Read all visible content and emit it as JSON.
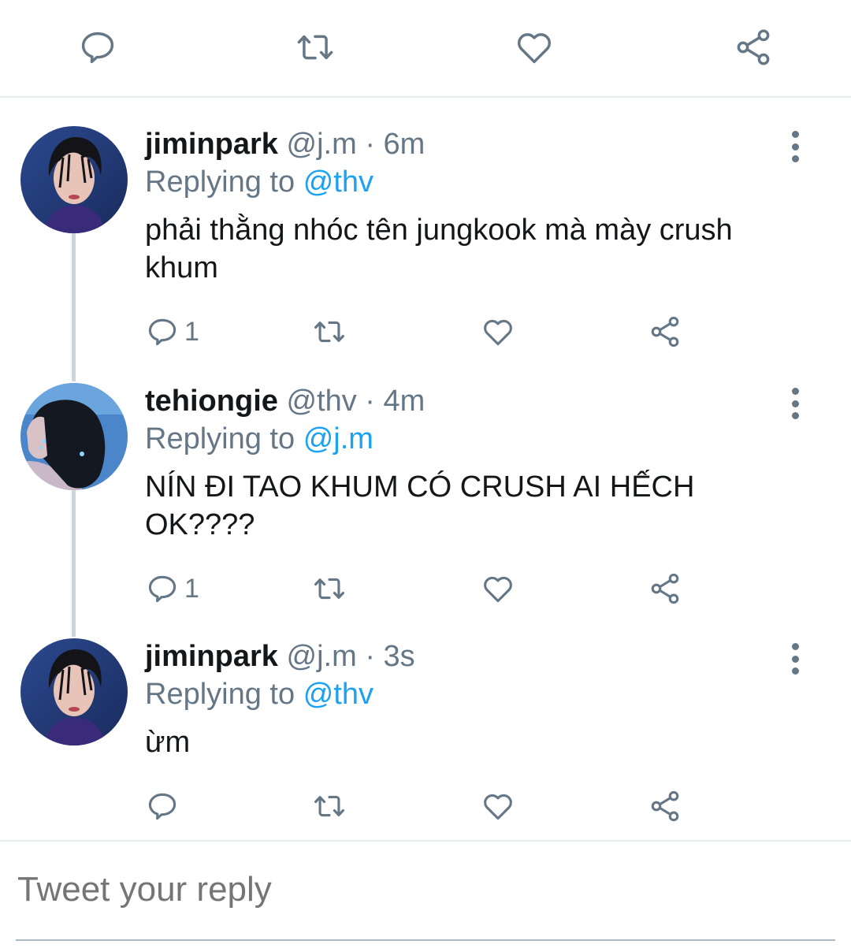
{
  "colors": {
    "accent": "#1da1f2",
    "muted": "#657786",
    "text": "#14171a",
    "divider": "#e6ecf0"
  },
  "top_actions": [
    "reply-icon",
    "retweet-icon",
    "like-icon",
    "share-icon"
  ],
  "tweets": [
    {
      "name": "jiminpark",
      "handle": "@j.m",
      "time": "6m",
      "separator": "·",
      "replying_prefix": "Replying to",
      "replying_to": "@thv",
      "text": "phải thằng nhóc tên jungkook mà mày crush khum",
      "reply_count": "1",
      "avatar": "jimin-avatar"
    },
    {
      "name": "tehiongie",
      "handle": "@thv",
      "time": "4m",
      "separator": "·",
      "replying_prefix": "Replying to",
      "replying_to": "@j.m",
      "text": "NÍN ĐI TAO KHUM CÓ CRUSH AI HẾCH OK????",
      "reply_count": "1",
      "avatar": "taehyung-avatar"
    },
    {
      "name": "jiminpark",
      "handle": "@j.m",
      "time": "3s",
      "separator": "·",
      "replying_prefix": "Replying to",
      "replying_to": "@thv",
      "text": "ừm",
      "reply_count": "",
      "avatar": "jimin-avatar"
    }
  ],
  "reply_box": {
    "placeholder": "Tweet your reply"
  }
}
